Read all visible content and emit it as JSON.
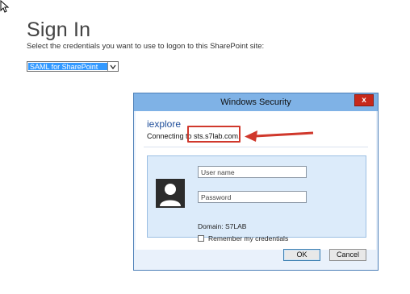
{
  "page": {
    "title": "Sign In",
    "instructions": "Select the credentials you want to use to logon to this SharePoint site:",
    "auth_provider_selected": "SAML for SharePoint"
  },
  "dialog": {
    "title": "Windows Security",
    "close_label": "x",
    "app_name": "iexplore",
    "connecting_text": "Connecting to sts.s7lab.com.",
    "username_placeholder": "User name",
    "password_placeholder": "Password",
    "domain_text": "Domain: S7LAB",
    "remember_label": "Remember my credentials",
    "ok_label": "OK",
    "cancel_label": "Cancel"
  },
  "icons": {
    "cursor": "mouse-pointer-icon",
    "dropdown": "chevron-down-icon",
    "avatar": "user-avatar-icon",
    "annotation": "red-arrow-icon"
  },
  "colors": {
    "selection_blue": "#3399ff",
    "titlebar_blue": "#7fb2e6",
    "close_red": "#c7281b",
    "annotation_red": "#d0382c",
    "tile_blue": "#dcebfa"
  }
}
